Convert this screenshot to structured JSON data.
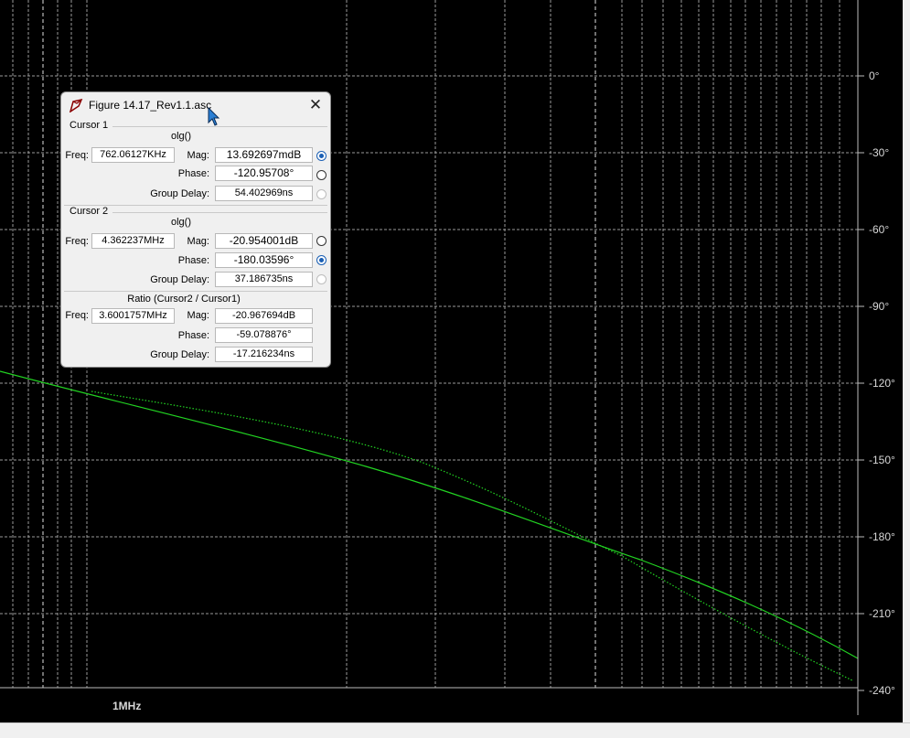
{
  "plot": {
    "phase_axis_labels": [
      "0°",
      "-30°",
      "-60°",
      "-90°",
      "-120°",
      "-150°",
      "-180°",
      "-210°",
      "-240°"
    ],
    "freq_axis_labels": [
      "1MHz"
    ],
    "trace_color": "#22d422",
    "grid_color": "#9a9a9a",
    "background": "#000000"
  },
  "dialog": {
    "title": "Figure 14.17_Rev1.1.asc",
    "cursor1": {
      "section": "Cursor 1",
      "trace": "olg()",
      "freq_label": "Freq:",
      "freq": "762.06127KHz",
      "mag_label": "Mag:",
      "mag": "13.692697mdB",
      "phase_label": "Phase:",
      "phase": "-120.95708°",
      "gd_label": "Group Delay:",
      "gd": "54.402969ns",
      "selected": "mag"
    },
    "cursor2": {
      "section": "Cursor 2",
      "trace": "olg()",
      "freq_label": "Freq:",
      "freq": "4.362237MHz",
      "mag_label": "Mag:",
      "mag": "-20.954001dB",
      "phase_label": "Phase:",
      "phase": "-180.03596°",
      "gd_label": "Group Delay:",
      "gd": "37.186735ns",
      "selected": "phase"
    },
    "ratio": {
      "section": "Ratio (Cursor2 / Cursor1)",
      "freq_label": "Freq:",
      "freq": "3.6001757MHz",
      "mag_label": "Mag:",
      "mag": "-20.967694dB",
      "phase_label": "Phase:",
      "phase": "-59.078876°",
      "gd_label": "Group Delay:",
      "gd": "-17.216234ns"
    }
  }
}
